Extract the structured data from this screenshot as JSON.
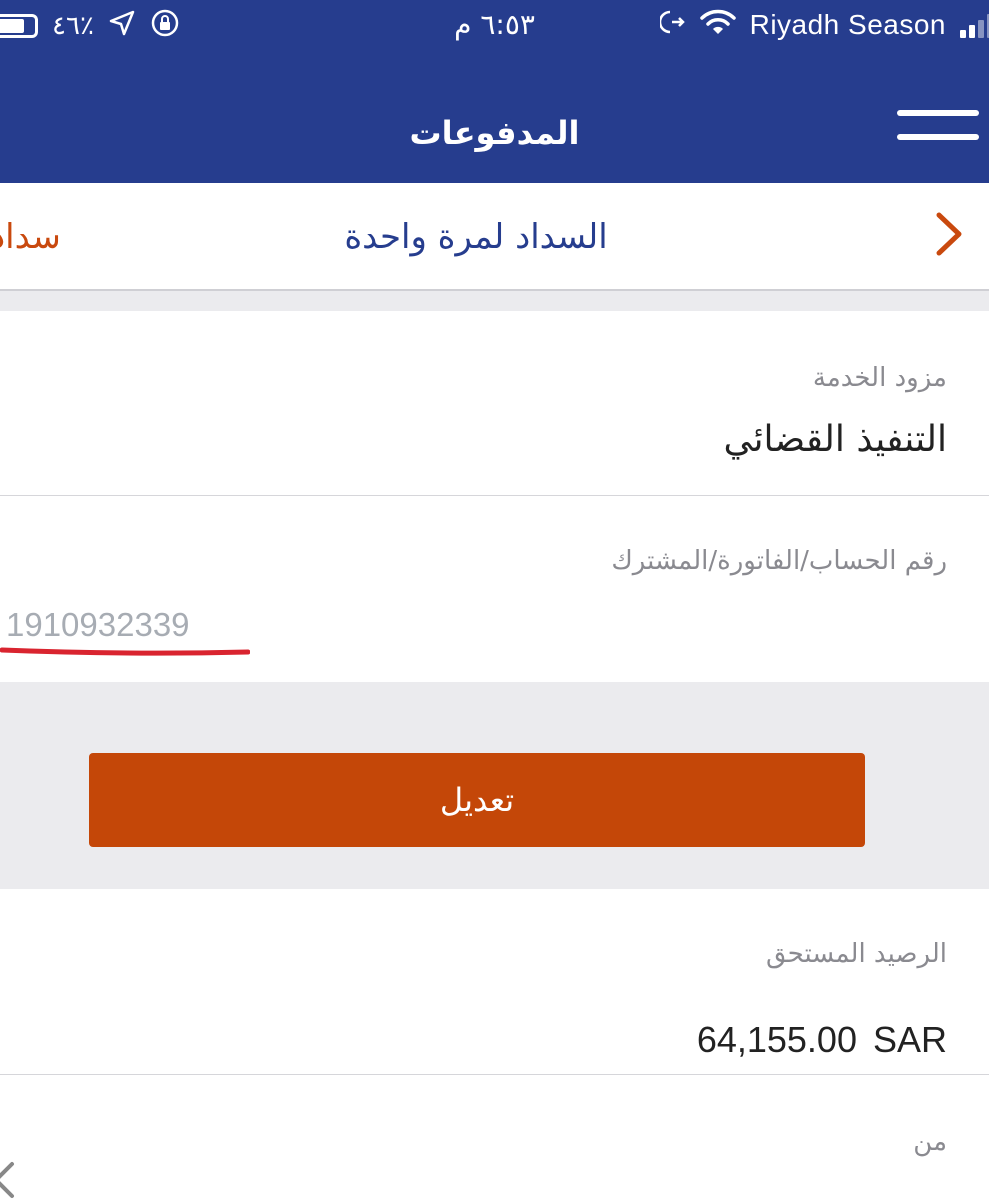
{
  "status_bar": {
    "battery_percent": "٪٤٦",
    "time": "٦:٥٣ م",
    "carrier": "Riyadh Season"
  },
  "header": {
    "title": "المدفوعات"
  },
  "tabs": {
    "active": "السداد لمرة واحدة",
    "next_partial": "سداد"
  },
  "form": {
    "service_provider_label": "مزود الخدمة",
    "service_provider_value": "التنفيذ القضائي",
    "account_label": "رقم الحساب/الفاتورة/المشترك",
    "account_value": "1910932339",
    "edit_button": "تعديل",
    "balance_label": "الرصيد المستحق",
    "balance_amount": "64,155.00",
    "balance_currency": "SAR",
    "from_label": "من"
  },
  "colors": {
    "brand_blue": "#263d8e",
    "accent_orange": "#c44708",
    "annotation_red": "#d9242f"
  }
}
